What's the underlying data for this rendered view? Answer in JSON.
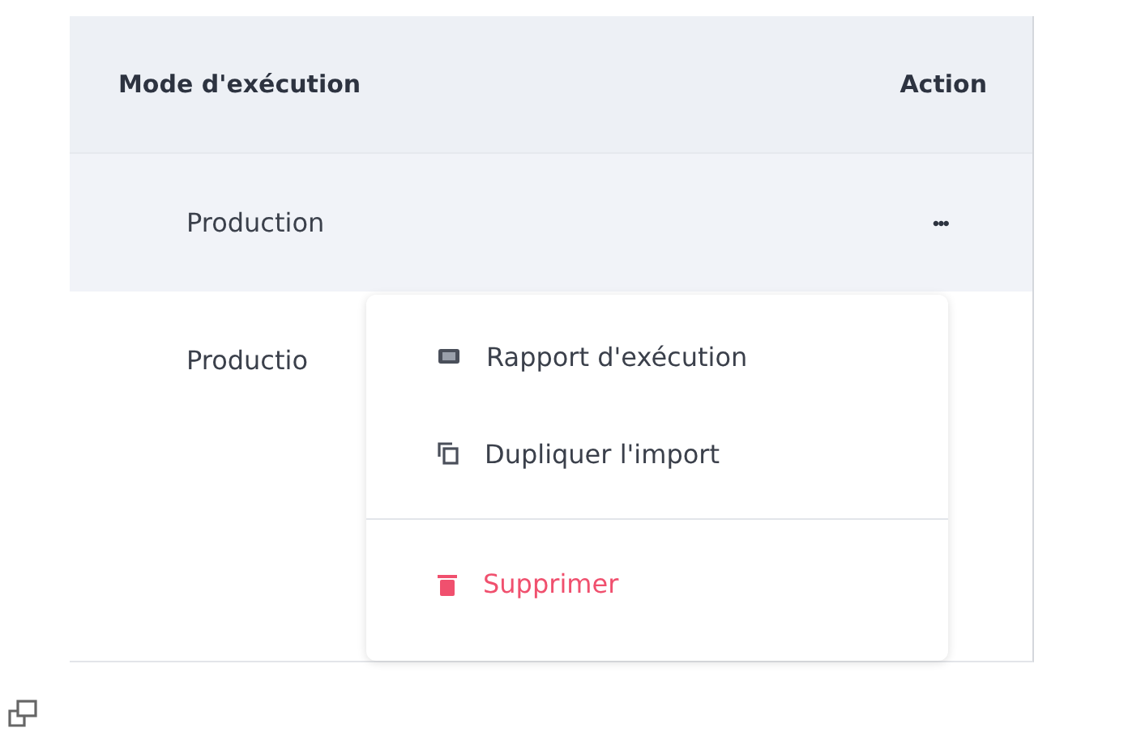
{
  "table": {
    "columns": [
      "Mode d'exécution",
      "Action"
    ],
    "rows": [
      {
        "mode": "Production",
        "selected": true,
        "action": "•••"
      },
      {
        "mode": "Productio",
        "selected": false
      }
    ]
  },
  "menu": {
    "items": [
      {
        "kind": "report",
        "label": "Rapport d'exécution"
      },
      {
        "kind": "duplicate",
        "label": "Dupliquer l'import"
      },
      {
        "kind": "delete",
        "label": "Supprimer"
      }
    ]
  }
}
